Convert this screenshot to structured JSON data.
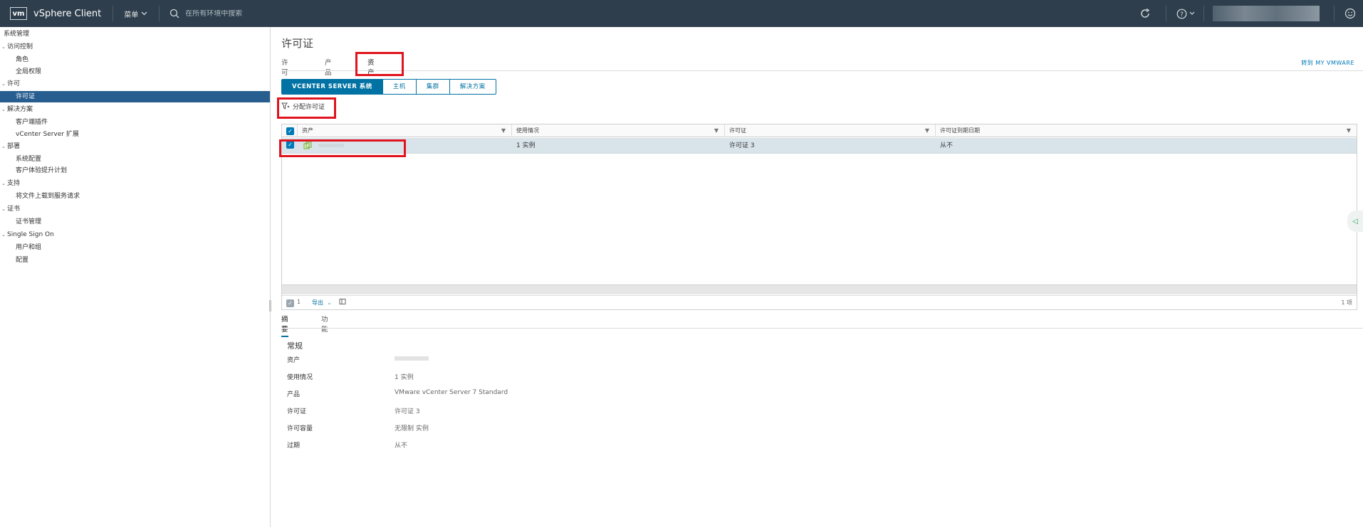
{
  "header": {
    "logo": "vm",
    "app_title": "vSphere Client",
    "menu_label": "菜单",
    "search_placeholder": "在所有环境中搜索"
  },
  "sidebar": {
    "items": [
      {
        "label": "系统管理",
        "level": 0,
        "caret": false
      },
      {
        "label": "访问控制",
        "level": 1,
        "caret": true
      },
      {
        "label": "角色",
        "level": 2,
        "caret": false
      },
      {
        "label": "全局权限",
        "level": 2,
        "caret": false
      },
      {
        "label": "许可",
        "level": 1,
        "caret": true
      },
      {
        "label": "许可证",
        "level": 2,
        "caret": false,
        "selected": true
      },
      {
        "label": "解决方案",
        "level": 1,
        "caret": true
      },
      {
        "label": "客户端插件",
        "level": 2,
        "caret": false
      },
      {
        "label": "vCenter Server 扩展",
        "level": 2,
        "caret": false
      },
      {
        "label": "部署",
        "level": 1,
        "caret": true
      },
      {
        "label": "系统配置",
        "level": 2,
        "caret": false
      },
      {
        "label": "客户体验提升计划",
        "level": 2,
        "caret": false
      },
      {
        "label": "支持",
        "level": 1,
        "caret": true
      },
      {
        "label": "将文件上载到服务请求",
        "level": 2,
        "caret": false
      },
      {
        "label": "证书",
        "level": 1,
        "caret": true
      },
      {
        "label": "证书管理",
        "level": 2,
        "caret": false
      },
      {
        "label": "Single Sign On",
        "level": 1,
        "caret": true
      },
      {
        "label": "用户和组",
        "level": 2,
        "caret": false
      },
      {
        "label": "配置",
        "level": 2,
        "caret": false
      }
    ]
  },
  "main": {
    "title": "许可证",
    "tabs": [
      "许可证",
      "产品",
      "资产"
    ],
    "active_tab": "资产",
    "my_vmware_link": "转到 MY VMWARE",
    "segments": [
      "VCENTER SERVER 系统",
      "主机",
      "集群",
      "解决方案"
    ],
    "assign_label": "分配许可证",
    "grid": {
      "columns": [
        "资产",
        "使用情况",
        "许可证",
        "许可证到期日期"
      ],
      "rows": [
        {
          "asset": "",
          "usage": "1 实例",
          "license": "许可证 3",
          "expiration": "从不"
        }
      ],
      "footer_selected": "1",
      "export_label": "导出",
      "item_count": "1 项"
    },
    "detail": {
      "tabs": [
        "摘要",
        "功能"
      ],
      "active_tab": "摘要",
      "section_title": "常规",
      "properties": [
        {
          "label": "资产",
          "value": ""
        },
        {
          "label": "使用情况",
          "value": "1 实例"
        },
        {
          "label": "产品",
          "value": "VMware vCenter Server 7 Standard"
        },
        {
          "label": "许可证",
          "value": "许可证 3"
        },
        {
          "label": "许可容量",
          "value": "无限制 实例"
        },
        {
          "label": "过期",
          "value": "从不"
        }
      ]
    }
  },
  "colors": {
    "header_bg": "#2e3e4c",
    "accent": "#0072a3",
    "selected_nav": "#275d8f",
    "highlight": "#e0141e"
  }
}
